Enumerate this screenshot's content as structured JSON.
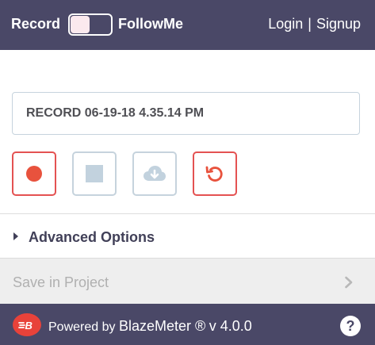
{
  "header": {
    "record_label": "Record",
    "follow_label": "FollowMe",
    "login_label": "Login",
    "separator": "|",
    "signup_label": "Signup",
    "toggle_state": "off",
    "background_color": "#4a4867"
  },
  "recording": {
    "name_value": "RECORD 06-19-18 4.35.14 PM"
  },
  "buttons": {
    "record_icon": "record-dot-icon",
    "stop_icon": "stop-square-icon",
    "cloud_icon": "cloud-download-icon",
    "reset_icon": "reset-icon",
    "accent_color": "#e45252"
  },
  "advanced": {
    "label": "Advanced Options"
  },
  "save": {
    "label": "Save in Project"
  },
  "footer": {
    "powered_label": "Powered by",
    "brand": "BlazeMeter ®",
    "version": "v 4.0.0",
    "help_label": "?",
    "logo_icon": "blazemeter-logo-icon"
  }
}
